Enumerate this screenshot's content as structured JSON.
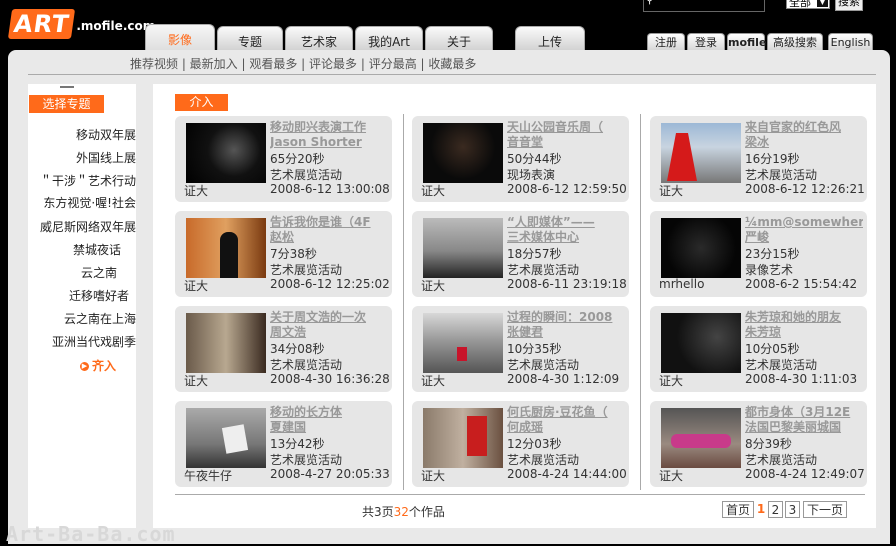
{
  "logo": {
    "art": "ART",
    "domain": ".mofile.com"
  },
  "search": {
    "scope": "全部",
    "button": "搜索"
  },
  "tabs": [
    "影像",
    "专题",
    "艺术家",
    "我的Art",
    "关于",
    "上传"
  ],
  "right_tabs": [
    "注册",
    "登录",
    "mofile",
    "高级搜索",
    "English"
  ],
  "subnav": "推荐视频 | 最新加入 | 观看最多 | 评论最多 | 评分最高 | 收藏最多",
  "sidebar": {
    "header": "选择专题",
    "items": [
      "移动双年展",
      "外国线上展",
      "＂干涉＂艺术行动",
      "东方视觉·喔!社会",
      "威尼斯网络双年展",
      "禁城夜话",
      "云之南",
      "迁移嗜好者",
      "云之南在上海",
      "亚洲当代戏剧季"
    ],
    "more": "齐入"
  },
  "content": {
    "intro_tab": "介入",
    "cards": [
      {
        "title1": "移动即兴表演工作",
        "title2": "Jason Shorter",
        "duration": "65分20秒",
        "category": "艺术展览活动",
        "user": "证大",
        "date": "2008-6-12 13:00:08"
      },
      {
        "title1": "天山公园音乐周（",
        "title2": "音音堂",
        "duration": "50分44秒",
        "category": "现场表演",
        "user": "证大",
        "date": "2008-6-12 12:59:50"
      },
      {
        "title1": "来自官家的红色风",
        "title2": "梁冰",
        "duration": "16分19秒",
        "category": "艺术展览活动",
        "user": "证大",
        "date": "2008-6-12 12:26:21"
      },
      {
        "title1": "告诉我你是谁（4F",
        "title2": "赵松",
        "duration": "7分38秒",
        "category": "艺术展览活动",
        "user": "证大",
        "date": "2008-6-12 12:25:02"
      },
      {
        "title1": "“人即媒体”——",
        "title2": "三术媒体中心",
        "duration": "18分57秒",
        "category": "艺术展览活动",
        "user": "证大",
        "date": "2008-6-11 23:19:18"
      },
      {
        "title1": "¼mm@somewher",
        "title2": "严峻",
        "duration": "23分15秒",
        "category": "录像艺术",
        "user": "mrhello",
        "date": "2008-6-2 15:54:42"
      },
      {
        "title1": "关于周文浩的一次",
        "title2": "周文浩",
        "duration": "34分08秒",
        "category": "艺术展览活动",
        "user": "证大",
        "date": "2008-4-30 16:36:28"
      },
      {
        "title1": "过程的瞬间：2008",
        "title2": "张健君",
        "duration": "10分35秒",
        "category": "艺术展览活动",
        "user": "证大",
        "date": "2008-4-30 1:12:09"
      },
      {
        "title1": "朱芳琼和她的朋友",
        "title2": "朱芳琼",
        "duration": "10分05秒",
        "category": "艺术展览活动",
        "user": "证大",
        "date": "2008-4-30 1:11:03"
      },
      {
        "title1": "移动的长方体",
        "title2": "夏建国",
        "duration": "13分42秒",
        "category": "艺术展览活动",
        "user": "午夜牛仔",
        "date": "2008-4-27 20:05:33"
      },
      {
        "title1": "何氏厨房·豆花鱼（",
        "title2": "何成瑶",
        "duration": "12分03秒",
        "category": "艺术展览活动",
        "user": "证大",
        "date": "2008-4-24 14:44:00"
      },
      {
        "title1": "都市身体（3月12E",
        "title2": "法国巴黎美丽城国",
        "duration": "8分39秒",
        "category": "艺术展览活动",
        "user": "证大",
        "date": "2008-4-24 12:49:07"
      }
    ]
  },
  "pagination": {
    "prefix": "共3页",
    "count": "32",
    "suffix": "个作品",
    "first": "首页",
    "pages": [
      "1",
      "2",
      "3"
    ],
    "next": "下一页"
  },
  "watermark": "Art-Ba-Ba.com",
  "colors": {
    "accent": "#ff6a1a",
    "panel": "#e9e9e9",
    "card": "#e6e6e6"
  }
}
